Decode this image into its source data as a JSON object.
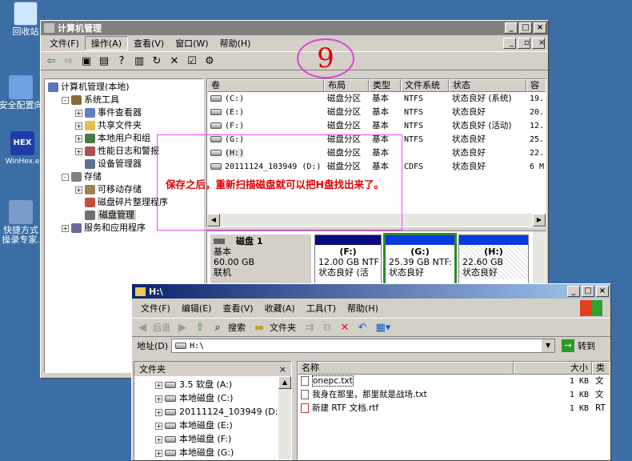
{
  "desktop": {
    "icons": [
      {
        "label": "回收站",
        "color": "#cfe8ff"
      },
      {
        "label": "安全配置向",
        "color": "#6fa0e0"
      },
      {
        "label1": "HEX",
        "label2": "WinHex.e",
        "color": "#1c3da8"
      },
      {
        "label1": "快捷方式",
        "label2": "操录专家.",
        "color": "#7a9cc8"
      }
    ]
  },
  "cm": {
    "title": "计算机管理",
    "menu": [
      "文件(F)",
      "操作(A)",
      "查看(V)",
      "窗口(W)",
      "帮助(H)"
    ],
    "step": "9",
    "tree": [
      {
        "label": "计算机管理(本地)",
        "lvl": 0,
        "exp": "",
        "icon": "#5a78b8"
      },
      {
        "label": "系统工具",
        "lvl": 1,
        "exp": "-",
        "icon": "#8a6a3a"
      },
      {
        "label": "事件查看器",
        "lvl": 2,
        "exp": "+",
        "icon": "#6080c0"
      },
      {
        "label": "共享文件夹",
        "lvl": 2,
        "exp": "+",
        "icon": "#e0c050"
      },
      {
        "label": "本地用户和组",
        "lvl": 2,
        "exp": "+",
        "icon": "#4a7a4a"
      },
      {
        "label": "性能日志和警报",
        "lvl": 2,
        "exp": "+",
        "icon": "#b05050"
      },
      {
        "label": "设备管理器",
        "lvl": 2,
        "exp": "",
        "icon": "#607090"
      },
      {
        "label": "存储",
        "lvl": 1,
        "exp": "-",
        "icon": "#808080"
      },
      {
        "label": "可移动存储",
        "lvl": 2,
        "exp": "+",
        "icon": "#a08050"
      },
      {
        "label": "磁盘碎片整理程序",
        "lvl": 2,
        "exp": "",
        "icon": "#c05040"
      },
      {
        "label": "磁盘管理",
        "lvl": 2,
        "exp": "",
        "icon": "#707070"
      },
      {
        "label": "服务和应用程序",
        "lvl": 1,
        "exp": "+",
        "icon": "#6a6a9a"
      }
    ],
    "cols": [
      "卷",
      "布局",
      "类型",
      "文件系统",
      "状态",
      "容"
    ],
    "rows": [
      {
        "vol": "(C:)",
        "layout": "磁盘分区",
        "type": "基本",
        "fs": "NTFS",
        "status": "状态良好 (系统)",
        "cap": "19."
      },
      {
        "vol": "(E:)",
        "layout": "磁盘分区",
        "type": "基本",
        "fs": "NTFS",
        "status": "状态良好",
        "cap": "20."
      },
      {
        "vol": "(F:)",
        "layout": "磁盘分区",
        "type": "基本",
        "fs": "NTFS",
        "status": "状态良好 (活动)",
        "cap": "12."
      },
      {
        "vol": "(G:)",
        "layout": "磁盘分区",
        "type": "基本",
        "fs": "NTFS",
        "status": "状态良好",
        "cap": "25."
      },
      {
        "vol": "(H:)",
        "layout": "磁盘分区",
        "type": "基本",
        "fs": "",
        "status": "状态良好",
        "cap": "22."
      },
      {
        "vol": "20111124_103949 (D:)",
        "layout": "磁盘分区",
        "type": "基本",
        "fs": "CDFS",
        "status": "状态良好",
        "cap": "6 M"
      }
    ],
    "annotation": "保存之后，重新扫描磁盘就可以把H盘找出来了。",
    "disk": {
      "name": "磁盘 1",
      "type": "基本",
      "size": "60.00 GB",
      "state": "联机",
      "parts": [
        {
          "label": "(F:)",
          "size": "12.00 GB NTF",
          "status": "状态良好 (活"
        },
        {
          "label": "(G:)",
          "size": "25.39 GB NTF:",
          "status": "状态良好"
        },
        {
          "label": "(H:)",
          "size": "22.60 GB",
          "status": "状态良好"
        }
      ]
    }
  },
  "ex": {
    "title": "H:\\",
    "menu": [
      "文件(F)",
      "编辑(E)",
      "查看(V)",
      "收藏(A)",
      "工具(T)",
      "帮助(H)"
    ],
    "back": "后退",
    "search": "搜索",
    "folders": "文件夹",
    "address_label": "地址(D)",
    "address_value": "H:\\",
    "go": "转到",
    "folders_header": "文件夹",
    "close": "×",
    "tree": [
      {
        "label": "3.5 软盘 (A:)"
      },
      {
        "label": "本地磁盘 (C:)"
      },
      {
        "label": "20111124_103949 (D:)"
      },
      {
        "label": "本地磁盘 (E:)"
      },
      {
        "label": "本地磁盘 (F:)"
      },
      {
        "label": "本地磁盘 (G:)"
      }
    ],
    "cols": [
      "名称",
      "大小",
      "类"
    ],
    "files": [
      {
        "name": "onepc.txt",
        "size": "1 KB",
        "type": "文"
      },
      {
        "name": "我身在那里，那里就是战场.txt",
        "size": "1 KB",
        "type": "文"
      },
      {
        "name": "新建 RTF 文档.rtf",
        "size": "1 KB",
        "type": "RT"
      }
    ]
  }
}
